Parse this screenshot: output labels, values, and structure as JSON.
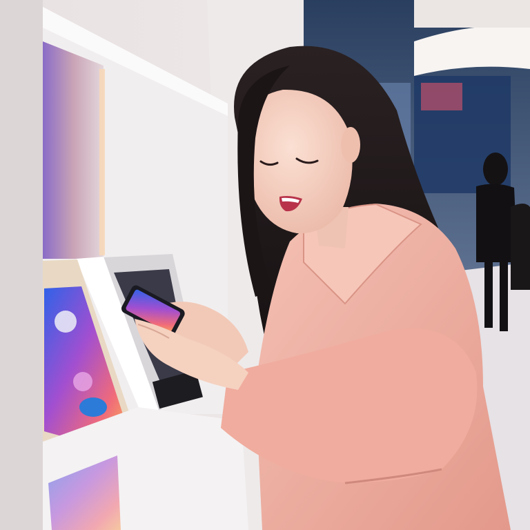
{
  "scene": {
    "description_visible_text": [],
    "palette": {
      "wall": "#ece6e6",
      "shelf": "#f3f0f1",
      "coat": "#f0b3a6",
      "coat_shadow": "#d58f83",
      "hair": "#1e1718",
      "skin": "#f6d3c4",
      "store_back": "#2b3f5e",
      "screen_glow_a": "#5b3ee0",
      "screen_glow_b": "#f08a5b"
    }
  }
}
